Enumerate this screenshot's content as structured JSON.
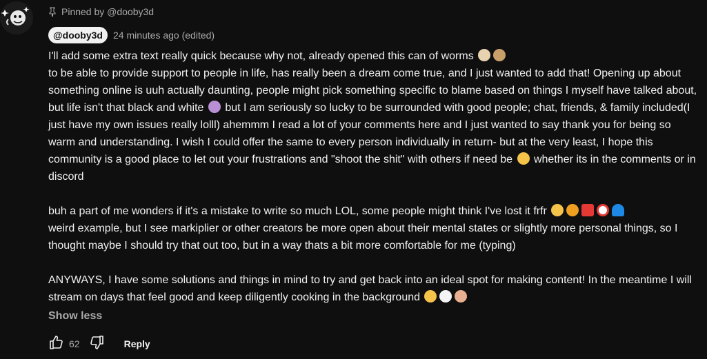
{
  "pinned": {
    "text": "Pinned by @dooby3d"
  },
  "author": {
    "handle": "@dooby3d",
    "timestamp": "24 minutes ago (edited)"
  },
  "comment": {
    "p1_line1": "I'll add some extra text really quick because why not, already opened this can of worms",
    "p1_a": "to be able to provide support to people in life, has really been a dream come true, and I just wanted to add that! Opening up about something online is uuh actually daunting, people might pick something specific to blame based on things I myself have talked about, but life isn't that black and white",
    "p1_b": "but I am seriously so lucky to be surrounded with good people; chat, friends, & family included(I just have my own issues really lolll) ahemmm I read a lot of your comments here and I just wanted to say thank you for being so warm and understanding. I wish I could offer the same to every person individually in return- but at the very least, I hope this community is a good place to let out your frustrations and \"shoot the shit\" with others if need be",
    "p1_c": "whether its in the comments or in discord",
    "p2_a": "buh a part of me wonders if it's a mistake to write so much LOL, some people might think I've lost it frfr",
    "p2_b": "weird example, but I see markiplier or other creators be more open about their mental states or slightly more personal things, so I thought maybe I should try that out too, but in a way thats a bit more comfortable for me (typing)",
    "p3_a": "ANYWAYS, I have some solutions and things in mind to try and get back into an ideal spot for making content! In the meantime I will stream on days that feel good and keep diligently cooking in the background"
  },
  "show_less_label": "Show less",
  "actions": {
    "like_count": "62",
    "reply_label": "Reply"
  },
  "colors": {
    "background": "#0f0f0f",
    "text": "#f1f1f1",
    "secondary_text": "#aaaaaa",
    "author_chip_bg": "#f1f1f1"
  }
}
